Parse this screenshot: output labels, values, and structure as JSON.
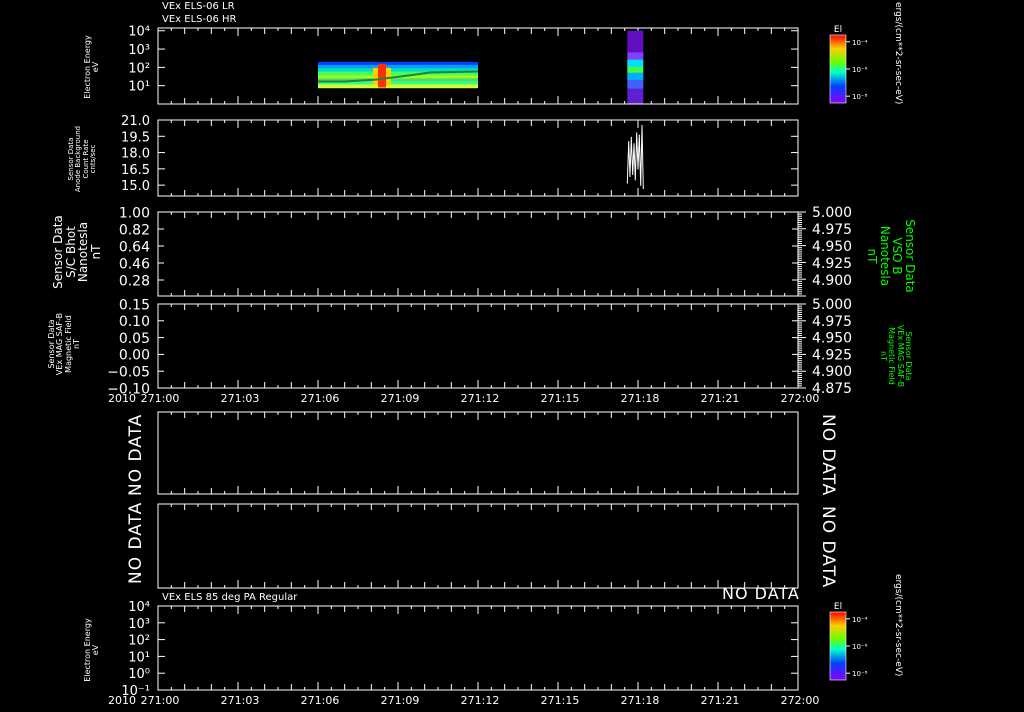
{
  "colors": {
    "background": "#000000",
    "axis": "#ffffff",
    "right_axis_label": "#00ff00",
    "trace": "#ffffff"
  },
  "titles": {
    "top_line1": "VEx ELS-06 LR",
    "top_line2": "VEx ELS-06 HR",
    "bottom": "VEx ELS 85 deg PA Regular"
  },
  "time_axis": {
    "year_label": "2010",
    "ticks": [
      "271:00",
      "271:03",
      "271:06",
      "271:09",
      "271:12",
      "271:15",
      "271:18",
      "271:21",
      "272:00"
    ]
  },
  "panels": {
    "p1": {
      "ylabel": [
        "Electron Energy",
        "eV"
      ],
      "ticks": [
        "10⁴",
        "10³",
        "10²",
        "10¹"
      ],
      "colorbar_title": "El",
      "colorbar_ticks": [
        "10⁻⁴",
        "10⁻⁶",
        "10⁻⁸"
      ],
      "colorbar_unit": "ergs/(cm**2-sr-sec-eV)"
    },
    "p2": {
      "ylabel": [
        "Sensor Data",
        "Anode Background",
        "Count Rate",
        "cnts/sec"
      ],
      "ticks": [
        "21.0",
        "19.5",
        "18.0",
        "16.5",
        "15.0"
      ]
    },
    "p3": {
      "ylabel": [
        "Sensor Data",
        "S/C Bhot",
        "Nanotesla",
        "nT"
      ],
      "ticks": [
        "1.00",
        "0.82",
        "0.64",
        "0.46",
        "0.28"
      ],
      "right_ylabel": [
        "Sensor Data",
        "VSO B",
        "Nanotesla",
        "nT"
      ],
      "right_ticks": [
        "5.000",
        "4.975",
        "4.950",
        "4.925",
        "4.900"
      ]
    },
    "p4": {
      "ylabel": [
        "Sensor Data",
        "VEx MAG SAF-B",
        "Magnetic Field",
        "nT"
      ],
      "ticks": [
        "0.15",
        "0.10",
        "0.05",
        "0.00",
        "−0.05",
        "−0.10"
      ],
      "right_ylabel": [
        "Sensor Data",
        "VEx MAG SAF-B",
        "Magnetic Field",
        "nT"
      ],
      "right_ticks": [
        "5.000",
        "4.975",
        "4.950",
        "4.925",
        "4.900",
        "4.875"
      ]
    },
    "p5": {
      "nodata_left": "NO DATA",
      "nodata_right": "NO DATA"
    },
    "p6": {
      "nodata_left": "NO DATA",
      "nodata_right": "NO DATA"
    },
    "p7": {
      "nodata": "NO DATA",
      "ylabel": [
        "Electron Energy",
        "eV"
      ],
      "ticks": [
        "10⁴",
        "10³",
        "10²",
        "10¹",
        "10⁰",
        "10⁻¹"
      ],
      "colorbar_title": "El",
      "colorbar_ticks": [
        "10⁻⁴",
        "10⁻⁶",
        "10⁻⁸"
      ],
      "colorbar_unit": "ergs/(cm**2-sr-sec-eV)"
    }
  },
  "chart_data": [
    {
      "type": "heatmap",
      "name": "VEx ELS-06 electron energy spectrogram",
      "x_unit": "day-of-year:hour (2010)",
      "xlim": [
        "271:00",
        "272:00"
      ],
      "ylabel": "Electron Energy eV",
      "yscale": "log",
      "ylim": [
        1,
        10000
      ],
      "blocks": [
        {
          "x_start": "271:06",
          "x_end": "271:12",
          "energy_range_eV": [
            8,
            200
          ]
        },
        {
          "x_start": "271:17.6",
          "x_end": "271:18.2",
          "energy_range_eV": [
            1,
            10000
          ]
        }
      ]
    },
    {
      "type": "line",
      "name": "Anode background count rate",
      "ylabel": "cnts/sec",
      "ylim": [
        14.0,
        21.0
      ],
      "x_hours": [
        17.6,
        17.65,
        17.7,
        17.75,
        17.8,
        17.85,
        17.9,
        17.95,
        18.0,
        18.05,
        18.1,
        18.15,
        18.2
      ],
      "y": [
        15.2,
        19.0,
        15.8,
        19.4,
        16.0,
        18.8,
        15.5,
        19.8,
        16.5,
        19.6,
        15.0,
        20.5,
        14.7
      ]
    },
    {
      "type": "line",
      "name": "S/C Bhot",
      "ylim": [
        0.19,
        1.0
      ],
      "right_ylim": [
        4.887,
        5.0
      ],
      "points": []
    },
    {
      "type": "line",
      "name": "VEx MAG SAF-B",
      "ylim": [
        -0.1,
        0.15
      ],
      "right_ylim": [
        4.875,
        5.0
      ],
      "points": []
    },
    {
      "type": "heatmap",
      "name": "VEx ELS 85 deg PA Regular",
      "yscale": "log",
      "ylim": [
        0.1,
        10000
      ],
      "points": []
    }
  ]
}
